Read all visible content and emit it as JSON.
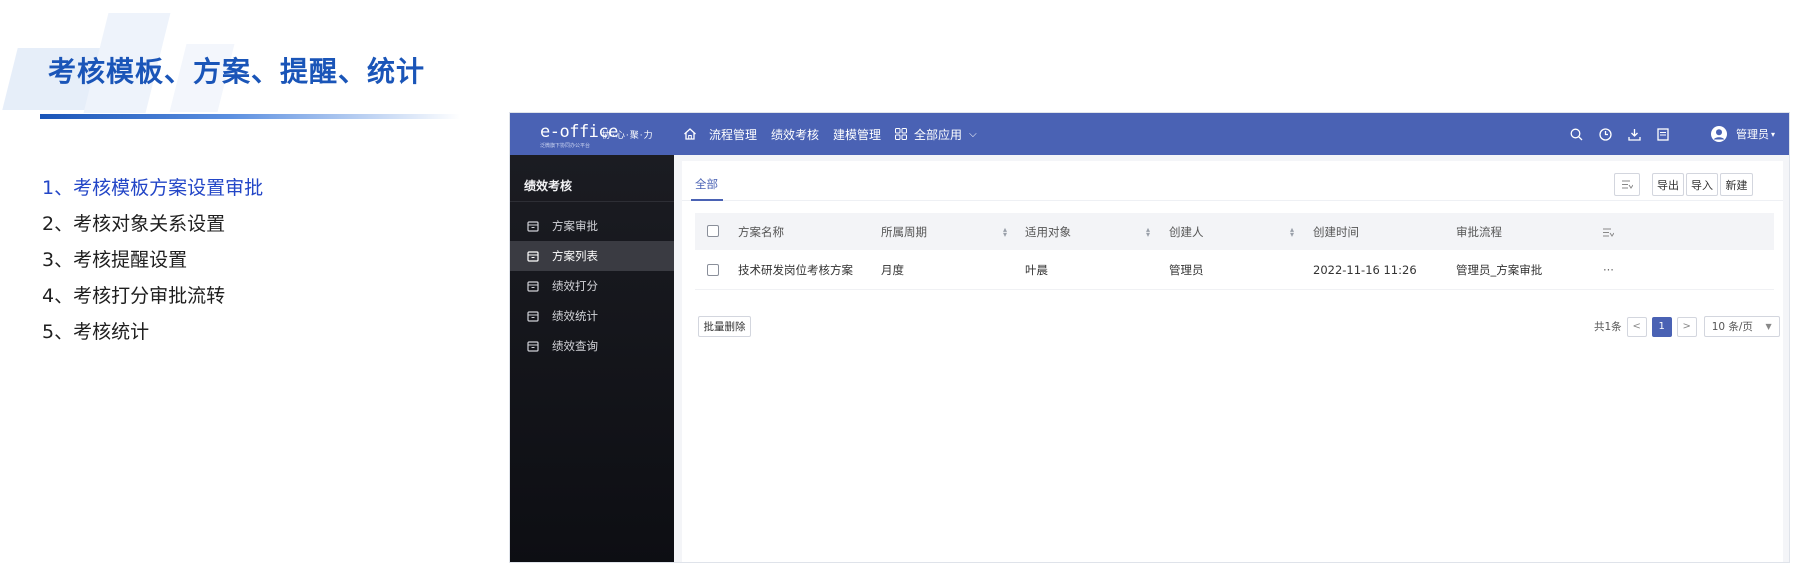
{
  "slide": {
    "title": "考核模板、方案、提醒、统计",
    "agenda": [
      "1、考核模板方案设置审批",
      "2、考核对象关系设置",
      "3、考核提醒设置",
      "4、考核打分审批流转",
      "5、考核统计"
    ]
  },
  "app": {
    "logo": "e-office",
    "logo_sub": "泛微旗下协同办公平台",
    "slogan": "协·心·聚·力",
    "nav": {
      "items": [
        "流程管理",
        "绩效考核",
        "建模管理"
      ],
      "all_apps": "全部应用"
    },
    "top_icons": [
      "search-icon",
      "clock-icon",
      "download-icon",
      "document-icon"
    ],
    "user": "管理员"
  },
  "sidebar": {
    "heading": "绩效考核",
    "items": [
      {
        "label": "方案审批",
        "active": false
      },
      {
        "label": "方案列表",
        "active": true
      },
      {
        "label": "绩效打分",
        "active": false
      },
      {
        "label": "绩效统计",
        "active": false
      },
      {
        "label": "绩效查询",
        "active": false
      }
    ]
  },
  "content": {
    "tab": "全部",
    "toolbar": {
      "export": "导出",
      "import": "导入",
      "new": "新建"
    },
    "table": {
      "columns": [
        "方案名称",
        "所属周期",
        "适用对象",
        "创建人",
        "创建时间",
        "审批流程"
      ],
      "rows": [
        [
          "技术研发岗位考核方案",
          "月度",
          "叶晨",
          "管理员",
          "2022-11-16 11:26",
          "管理员_方案审批"
        ]
      ],
      "row_action": "···"
    },
    "bulk_delete": "批量删除",
    "pagination": {
      "total": "共1条",
      "current_page": "1",
      "page_size": "10 条/页"
    }
  },
  "colors": {
    "accent": "#4a62b4",
    "title_blue": "#1a55b8",
    "sidebar_bg": "#15161c"
  }
}
